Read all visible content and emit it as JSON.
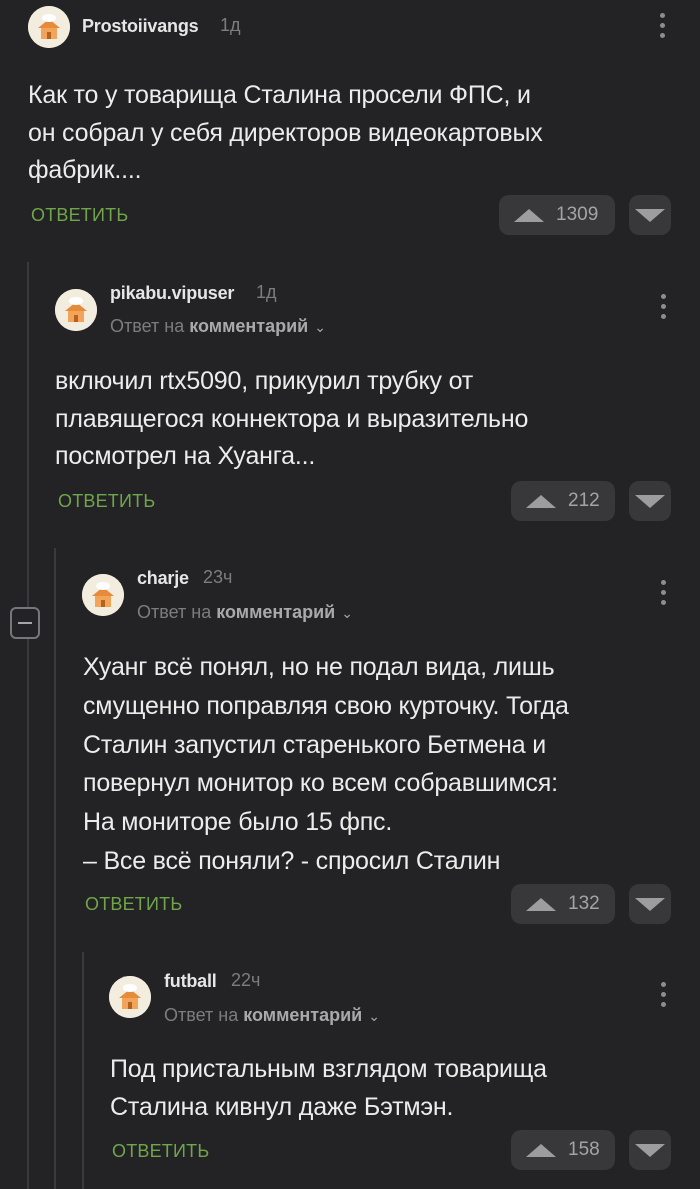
{
  "reply_label": "ОТВЕТИТЬ",
  "reply_to_prefix": "Ответ на",
  "reply_to_link": "комментарий",
  "comments": [
    {
      "username": "Prostoiivangs",
      "time": "1д",
      "lines": [
        "Как то у товарища Сталина просели ФПС, и",
        "он собрал у себя директоров видеокартовых",
        "фабрик...."
      ],
      "rating": "1309"
    },
    {
      "username": "pikabu.vipuser",
      "time": "1д",
      "lines": [
        "включил rtx5090, прикурил трубку от",
        "плавящегося коннектора и выразительно",
        "посмотрел на Хуанга..."
      ],
      "rating": "212"
    },
    {
      "username": "charje",
      "time": "23ч",
      "lines": [
        "Хуанг всё понял, но не подал вида, лишь",
        "смущенно поправляя свою курточку. Тогда",
        "Сталин запустил старенького Бетмена и",
        "повернул монитор ко всем собравшимся:",
        "На мониторе было 15 фпс.",
        "– Все всё поняли? - спросил Сталин"
      ],
      "rating": "132"
    },
    {
      "username": "futball",
      "time": "22ч",
      "lines": [
        "Под пристальным взглядом товарища",
        "Сталина кивнул даже Бэтмэн."
      ],
      "rating": "158"
    }
  ],
  "colors": {
    "background": "#232325",
    "reply_green": "#6fa64a",
    "button_bg": "#38383b"
  },
  "icons": [
    "avatar-chef-house",
    "kebab-menu-icon",
    "upvote-arrow-icon",
    "downvote-arrow-icon",
    "chevron-down-icon",
    "collapse-minus-icon"
  ]
}
